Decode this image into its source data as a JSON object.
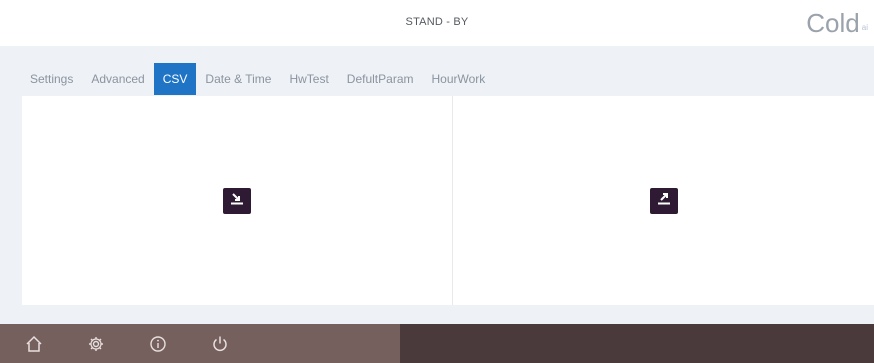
{
  "header": {
    "status_text": "STAND - BY",
    "brand": "Cold",
    "brand_sup": "ai"
  },
  "tabs": [
    {
      "label": "Settings",
      "active": false
    },
    {
      "label": "Advanced",
      "active": false
    },
    {
      "label": "CSV",
      "active": true
    },
    {
      "label": "Date & Time",
      "active": false
    },
    {
      "label": "HwTest",
      "active": false
    },
    {
      "label": "DefultParam",
      "active": false
    },
    {
      "label": "HourWork",
      "active": false
    }
  ],
  "panels": {
    "left": {
      "icon": "import-icon"
    },
    "right": {
      "icon": "export-icon"
    }
  },
  "footer": {
    "icons": [
      "home-icon",
      "gear-icon",
      "info-icon",
      "power-icon"
    ]
  },
  "colors": {
    "accent": "#1f74c6",
    "button_bg": "#2e1b33",
    "footer_left": "#75605e",
    "footer_right": "#4a3a3c"
  }
}
